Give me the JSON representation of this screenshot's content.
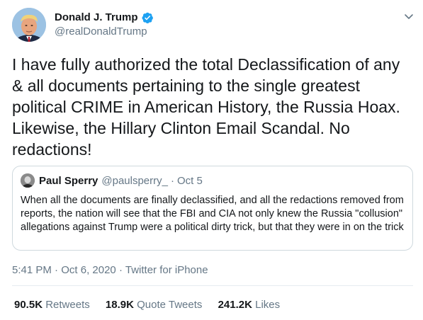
{
  "author": {
    "name": "Donald J. Trump",
    "handle": "@realDonaldTrump",
    "verified": true
  },
  "tweet": {
    "text": "I have fully authorized the total Declassification of any & all documents pertaining to the single greatest political CRIME in American History, the Russia Hoax. Likewise, the Hillary Clinton Email Scandal. No redactions!"
  },
  "quoted_tweet": {
    "name": "Paul Sperry",
    "handle": "@paulsperry_",
    "separator": "·",
    "date": "Oct 5",
    "text": "When all the documents are finally declassified, and all the redactions removed from reports, the nation will see that the FBI and CIA not only knew the Russia \"collusion\" allegations against Trump were a political dirty trick, but that they were in on the trick"
  },
  "meta": {
    "time": "5:41 PM",
    "separator": "·",
    "date": "Oct 6, 2020",
    "source": "Twitter for iPhone"
  },
  "stats": {
    "retweets_value": "90.5K",
    "retweets_label": "Retweets",
    "quotes_value": "18.9K",
    "quotes_label": "Quote Tweets",
    "likes_value": "241.2K",
    "likes_label": "Likes"
  },
  "icons": {
    "verified": "verified-badge-icon",
    "more": "chevron-down-icon"
  },
  "colors": {
    "verified": "#1da1f2",
    "secondary_text": "#657786",
    "border": "#cfd9de"
  }
}
